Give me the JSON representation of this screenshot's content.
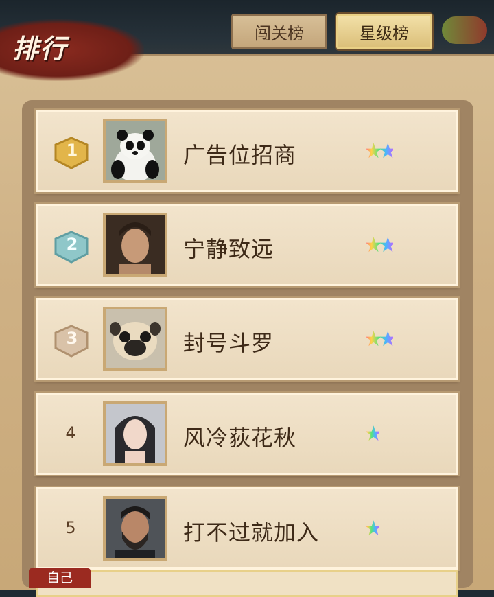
{
  "header": {
    "title": "排行",
    "tabs": [
      {
        "label": "闯关榜",
        "active": false
      },
      {
        "label": "星级榜",
        "active": true
      }
    ]
  },
  "rankings": [
    {
      "rank": "1",
      "name": "广告位招商",
      "stars": "★★",
      "avatar": "panda-avatar"
    },
    {
      "rank": "2",
      "name": "宁静致远",
      "stars": "★★",
      "avatar": "man-portrait-avatar"
    },
    {
      "rank": "3",
      "name": "封号斗罗",
      "stars": "★★",
      "avatar": "pug-avatar"
    },
    {
      "rank": "4",
      "name": "风冷荻花秋",
      "stars": "★",
      "avatar": "woman-portrait-avatar"
    },
    {
      "rank": "5",
      "name": "打不过就加入",
      "stars": "★",
      "avatar": "bearded-man-avatar"
    }
  ],
  "self": {
    "label": "自己"
  },
  "colors": {
    "gold": "#e2b54a",
    "silver": "#8fc7c9",
    "bronze": "#c9a98a",
    "accent_red": "#9b2a20"
  }
}
